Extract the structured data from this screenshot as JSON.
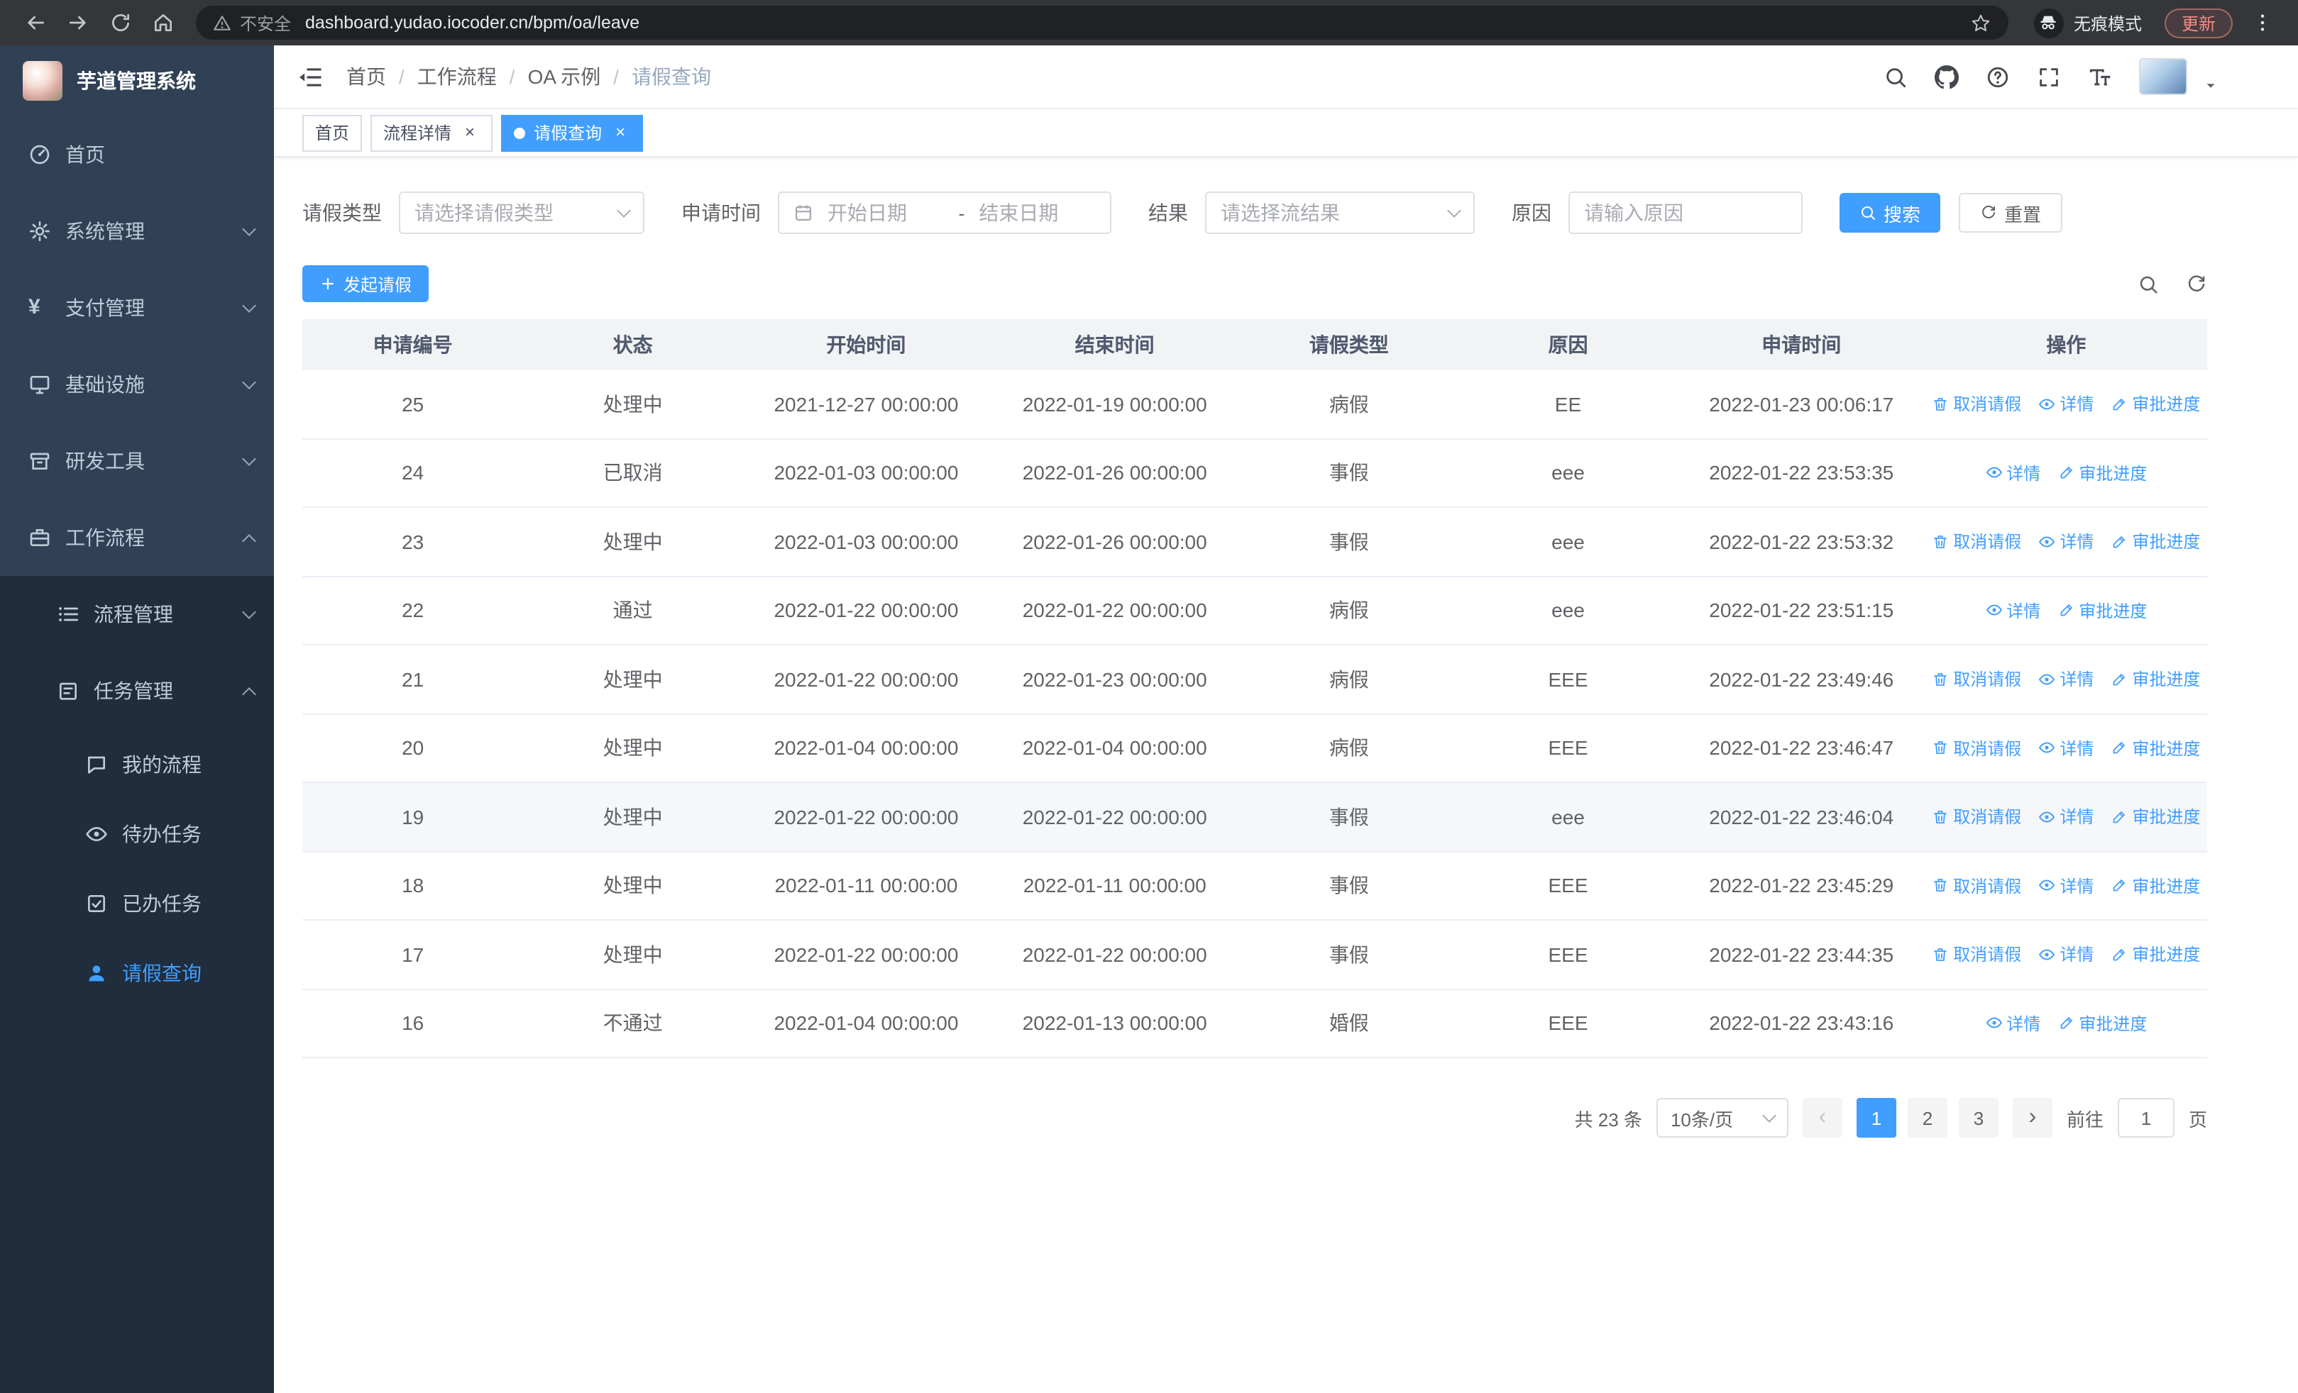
{
  "colors": {
    "accent": "#409EFF",
    "sidebar_bg": "#304156",
    "sidebar_submenu_bg": "#1F2D3D",
    "chrome_bg": "#35363A",
    "active_tab_bg": "#409EFF",
    "link": "#409EFF",
    "update_badge_text": "#F28B82"
  },
  "browser": {
    "security_label": "不安全",
    "url": "dashboard.yudao.iocoder.cn/bpm/oa/leave",
    "incognito_label": "无痕模式",
    "update_label": "更新"
  },
  "sidebar": {
    "logo_title": "芋道管理系统",
    "items": [
      {
        "label": "首页",
        "slug": "home",
        "icon": "dashboard",
        "level": 1
      },
      {
        "label": "系统管理",
        "slug": "system-management",
        "icon": "gear",
        "level": 1,
        "arrow": "down"
      },
      {
        "label": "支付管理",
        "slug": "payment-management",
        "icon": "yen",
        "level": 1,
        "arrow": "down"
      },
      {
        "label": "基础设施",
        "slug": "infrastructure",
        "icon": "monitor",
        "level": 1,
        "arrow": "down"
      },
      {
        "label": "研发工具",
        "slug": "dev-tools",
        "icon": "toolbox",
        "level": 1,
        "arrow": "down"
      },
      {
        "label": "工作流程",
        "slug": "workflow",
        "icon": "briefcase",
        "level": 1,
        "arrow": "up",
        "expanded": true
      },
      {
        "label": "流程管理",
        "slug": "process-management",
        "icon": "flow",
        "level": 2,
        "arrow": "down"
      },
      {
        "label": "任务管理",
        "slug": "task-management",
        "icon": "tasks",
        "level": 2,
        "arrow": "up",
        "expanded": true
      },
      {
        "label": "我的流程",
        "slug": "my-processes",
        "icon": "chat",
        "level": 3
      },
      {
        "label": "待办任务",
        "slug": "todo-tasks",
        "icon": "eye",
        "level": 3
      },
      {
        "label": "已办任务",
        "slug": "done-tasks",
        "icon": "done",
        "level": 3
      },
      {
        "label": "请假查询",
        "slug": "leave-query",
        "icon": "user",
        "level": 3,
        "active": true
      }
    ]
  },
  "navbar": {
    "breadcrumb": [
      {
        "label": "首页"
      },
      {
        "label": "工作流程"
      },
      {
        "label": "OA 示例"
      },
      {
        "label": "请假查询",
        "current": true
      }
    ]
  },
  "tabs": [
    {
      "label": "首页",
      "slug": "home"
    },
    {
      "label": "流程详情",
      "slug": "process-detail",
      "closable": true
    },
    {
      "label": "请假查询",
      "slug": "leave-query",
      "closable": true,
      "active": true
    }
  ],
  "filters": {
    "leave_type_label": "请假类型",
    "leave_type_placeholder": "请选择请假类型",
    "apply_time_label": "申请时间",
    "start_date_placeholder": "开始日期",
    "range_separator": "-",
    "end_date_placeholder": "结束日期",
    "result_label": "结果",
    "result_placeholder": "请选择流结果",
    "reason_label": "原因",
    "reason_placeholder": "请输入原因",
    "search_button": "搜索",
    "reset_button": "重置"
  },
  "toolbar": {
    "create_button": "发起请假"
  },
  "table": {
    "columns": [
      "申请编号",
      "状态",
      "开始时间",
      "结束时间",
      "请假类型",
      "原因",
      "申请时间",
      "操作"
    ],
    "action_labels": {
      "cancel": "取消请假",
      "detail": "详情",
      "progress": "审批进度"
    },
    "rows": [
      {
        "id": "25",
        "status": "处理中",
        "start": "2021-12-27 00:00:00",
        "end": "2022-01-19 00:00:00",
        "type": "病假",
        "reason": "EE",
        "apply_time": "2022-01-23 00:06:17",
        "actions": [
          "cancel",
          "detail",
          "progress"
        ]
      },
      {
        "id": "24",
        "status": "已取消",
        "start": "2022-01-03 00:00:00",
        "end": "2022-01-26 00:00:00",
        "type": "事假",
        "reason": "eee",
        "apply_time": "2022-01-22 23:53:35",
        "actions": [
          "detail",
          "progress"
        ]
      },
      {
        "id": "23",
        "status": "处理中",
        "start": "2022-01-03 00:00:00",
        "end": "2022-01-26 00:00:00",
        "type": "事假",
        "reason": "eee",
        "apply_time": "2022-01-22 23:53:32",
        "actions": [
          "cancel",
          "detail",
          "progress"
        ]
      },
      {
        "id": "22",
        "status": "通过",
        "start": "2022-01-22 00:00:00",
        "end": "2022-01-22 00:00:00",
        "type": "病假",
        "reason": "eee",
        "apply_time": "2022-01-22 23:51:15",
        "actions": [
          "detail",
          "progress"
        ]
      },
      {
        "id": "21",
        "status": "处理中",
        "start": "2022-01-22 00:00:00",
        "end": "2022-01-23 00:00:00",
        "type": "病假",
        "reason": "EEE",
        "apply_time": "2022-01-22 23:49:46",
        "actions": [
          "cancel",
          "detail",
          "progress"
        ]
      },
      {
        "id": "20",
        "status": "处理中",
        "start": "2022-01-04 00:00:00",
        "end": "2022-01-04 00:00:00",
        "type": "病假",
        "reason": "EEE",
        "apply_time": "2022-01-22 23:46:47",
        "actions": [
          "cancel",
          "detail",
          "progress"
        ]
      },
      {
        "id": "19",
        "status": "处理中",
        "start": "2022-01-22 00:00:00",
        "end": "2022-01-22 00:00:00",
        "type": "事假",
        "reason": "eee",
        "apply_time": "2022-01-22 23:46:04",
        "actions": [
          "cancel",
          "detail",
          "progress"
        ],
        "highlighted": true
      },
      {
        "id": "18",
        "status": "处理中",
        "start": "2022-01-11 00:00:00",
        "end": "2022-01-11 00:00:00",
        "type": "事假",
        "reason": "EEE",
        "apply_time": "2022-01-22 23:45:29",
        "actions": [
          "cancel",
          "detail",
          "progress"
        ]
      },
      {
        "id": "17",
        "status": "处理中",
        "start": "2022-01-22 00:00:00",
        "end": "2022-01-22 00:00:00",
        "type": "事假",
        "reason": "EEE",
        "apply_time": "2022-01-22 23:44:35",
        "actions": [
          "cancel",
          "detail",
          "progress"
        ]
      },
      {
        "id": "16",
        "status": "不通过",
        "start": "2022-01-04 00:00:00",
        "end": "2022-01-13 00:00:00",
        "type": "婚假",
        "reason": "EEE",
        "apply_time": "2022-01-22 23:43:16",
        "actions": [
          "detail",
          "progress"
        ]
      }
    ]
  },
  "pagination": {
    "total_text": "共 23 条",
    "page_size_value": "10条/页",
    "pages": [
      "1",
      "2",
      "3"
    ],
    "active_page": "1",
    "prev_symbol": "‹",
    "next_symbol": "›",
    "goto_label": "前往",
    "goto_value": "1",
    "goto_suffix": "页"
  }
}
